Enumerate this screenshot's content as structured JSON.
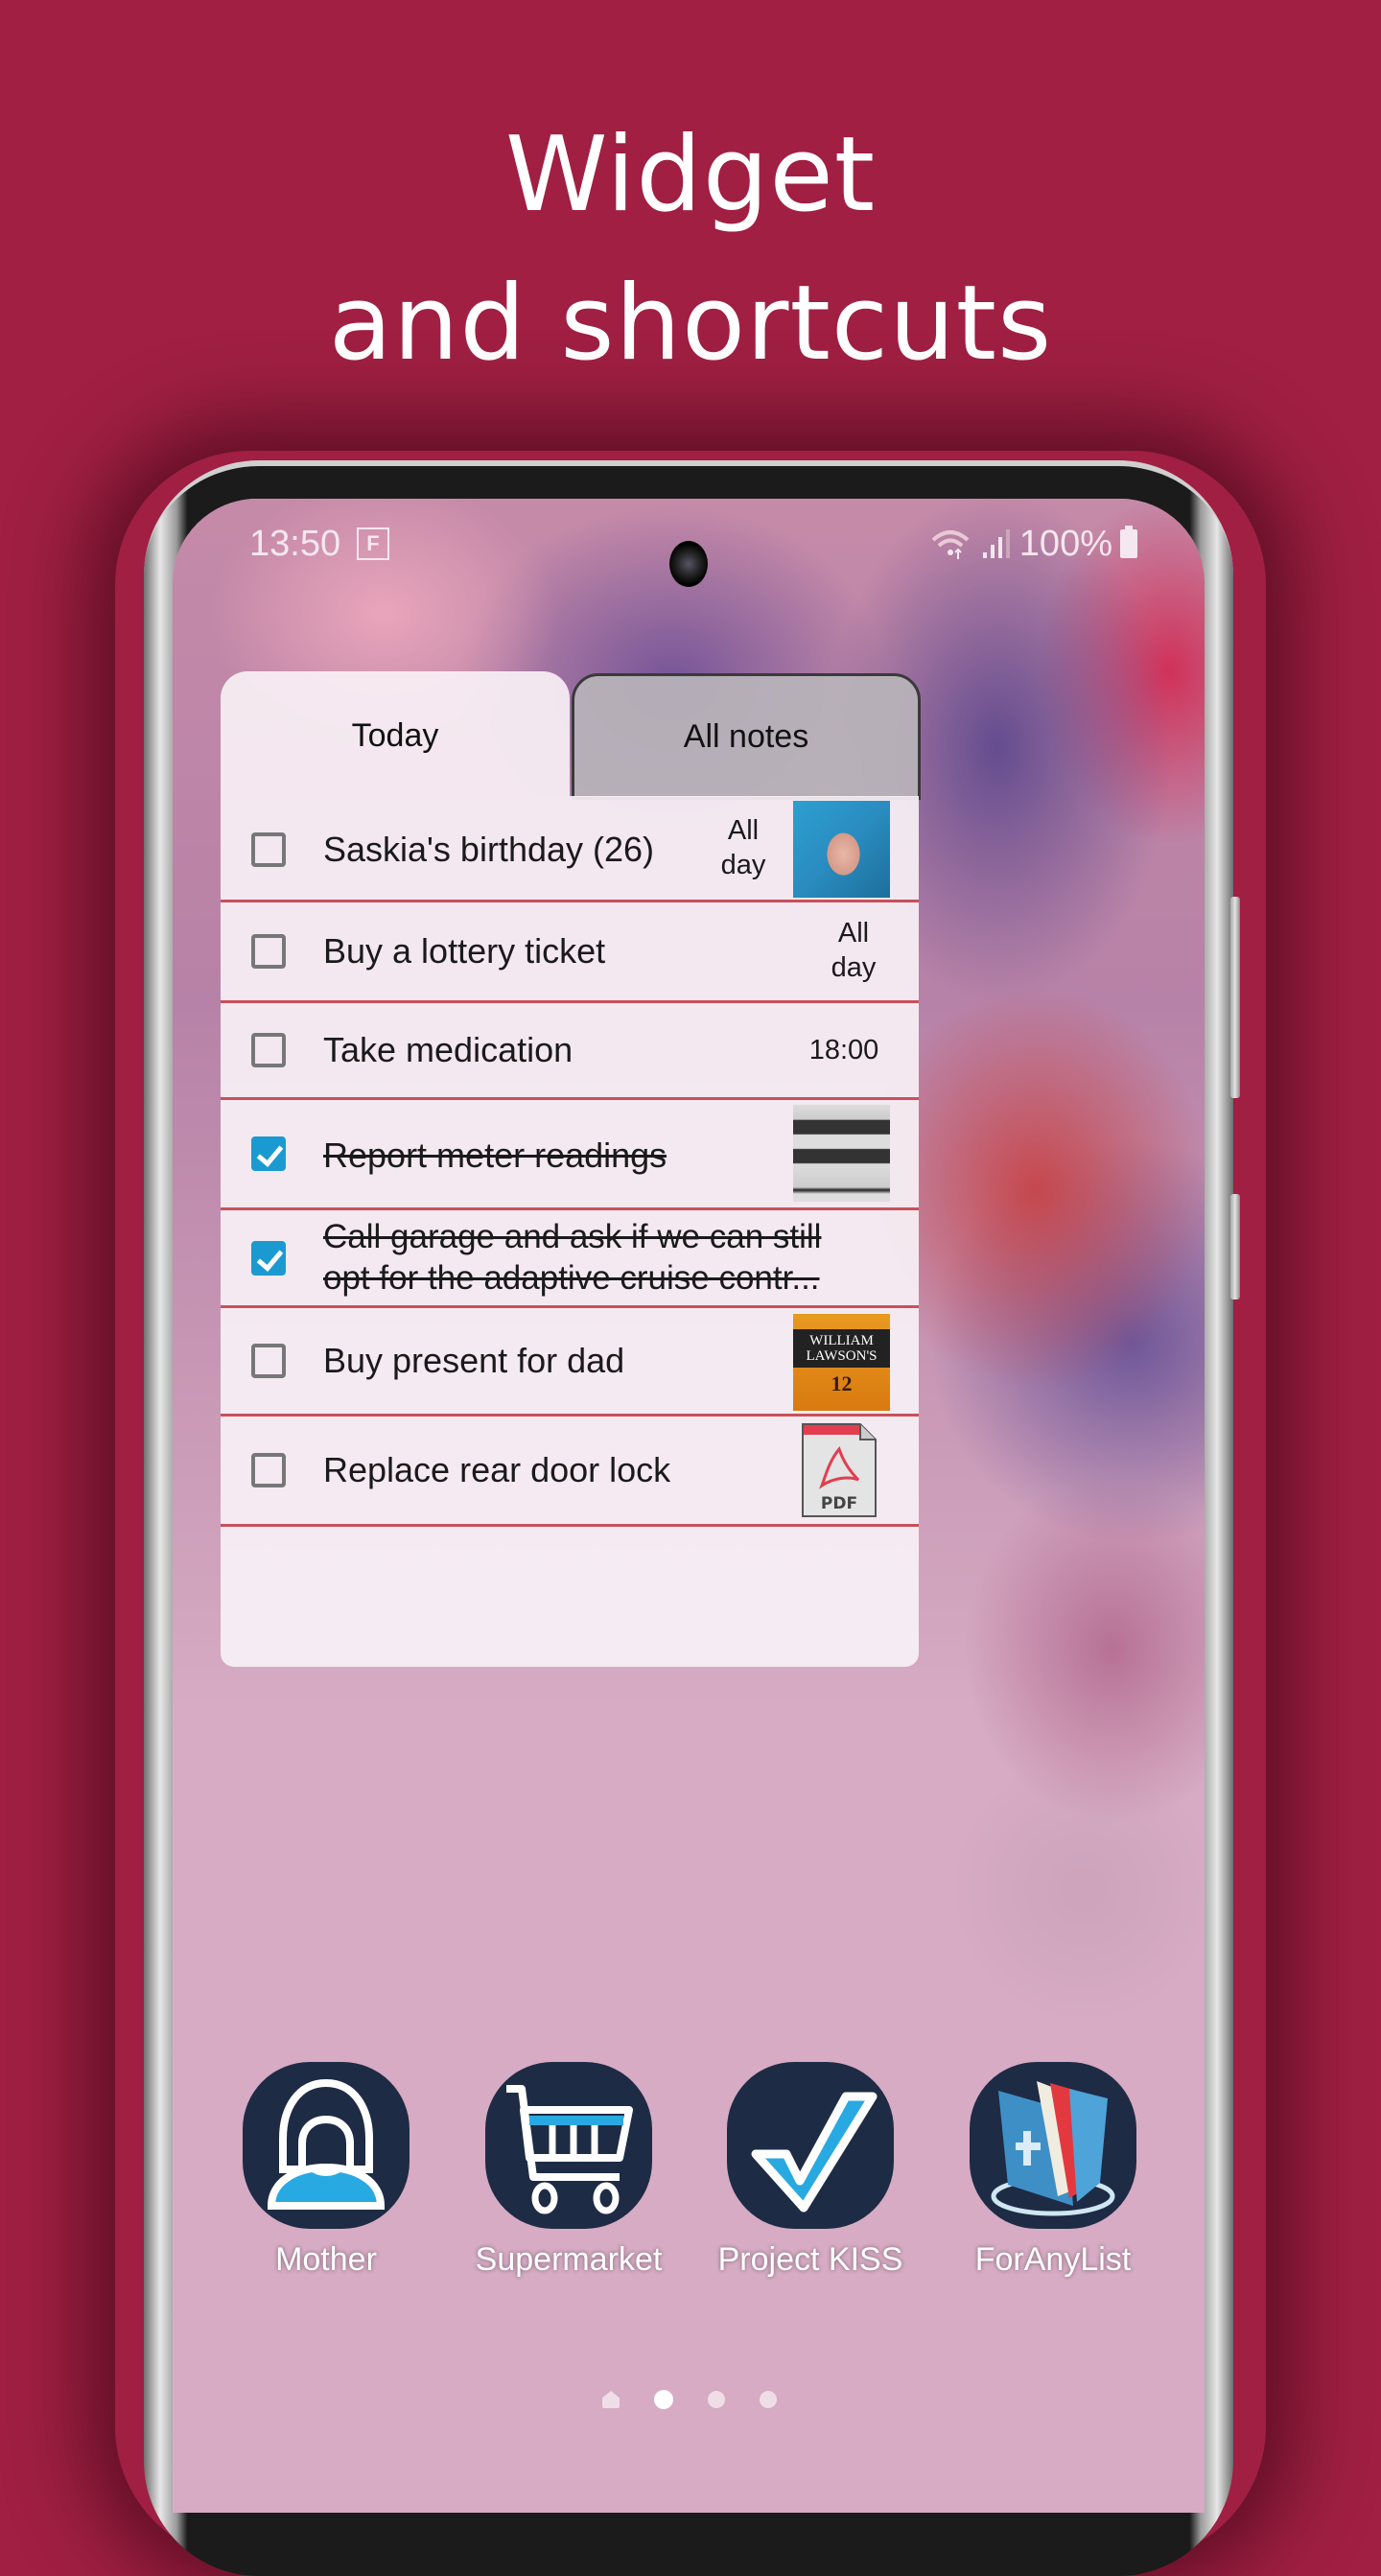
{
  "headline": {
    "line1": "Widget",
    "line2": "and shortcuts"
  },
  "status_bar": {
    "time": "13:50",
    "notification_badge": "F",
    "icons": [
      "wifi-icon",
      "signal-icon"
    ],
    "battery_percent": "100%"
  },
  "widget": {
    "tabs": [
      {
        "label": "Today",
        "active": true
      },
      {
        "label": "All notes",
        "active": false
      }
    ],
    "items": [
      {
        "text": "Saskia's birthday (26)",
        "checked": false,
        "time": "All\nday",
        "attachment": "photo-thumbnail"
      },
      {
        "text": "Buy a lottery ticket",
        "checked": false,
        "time": "All\nday",
        "attachment": null
      },
      {
        "text": "Take medication",
        "checked": false,
        "time": "18:00",
        "attachment": null
      },
      {
        "text": "Report meter readings",
        "checked": true,
        "time": "",
        "attachment": "meter-thumbnail"
      },
      {
        "text": "Call garage and ask if we can still opt for the adaptive cruise contr...",
        "checked": true,
        "time": "",
        "attachment": null
      },
      {
        "text": "Buy present for dad",
        "checked": false,
        "time": "",
        "attachment": "whisky-thumbnail"
      },
      {
        "text": "Replace rear door lock",
        "checked": false,
        "time": "",
        "attachment": "pdf-file"
      }
    ],
    "whisky_label": "WILLIAM LAWSON'S",
    "whisky_age": "12",
    "pdf_label": "PDF"
  },
  "shortcuts": [
    {
      "label": "Mother",
      "icon": "person-icon"
    },
    {
      "label": "Supermarket",
      "icon": "shopping-cart-icon"
    },
    {
      "label": "Project KISS",
      "icon": "checkmark-icon"
    },
    {
      "label": "ForAnyList",
      "icon": "folder-icon"
    }
  ],
  "page_indicator": {
    "pages": 4,
    "active_index": 1,
    "first_is_home": true
  },
  "colors": {
    "background": "#a01f42",
    "checkbox_checked": "#1b9ad1",
    "row_divider": "#c8505c",
    "shortcut_bg": "#1e2b44",
    "icon_accent": "#29a9e1"
  }
}
